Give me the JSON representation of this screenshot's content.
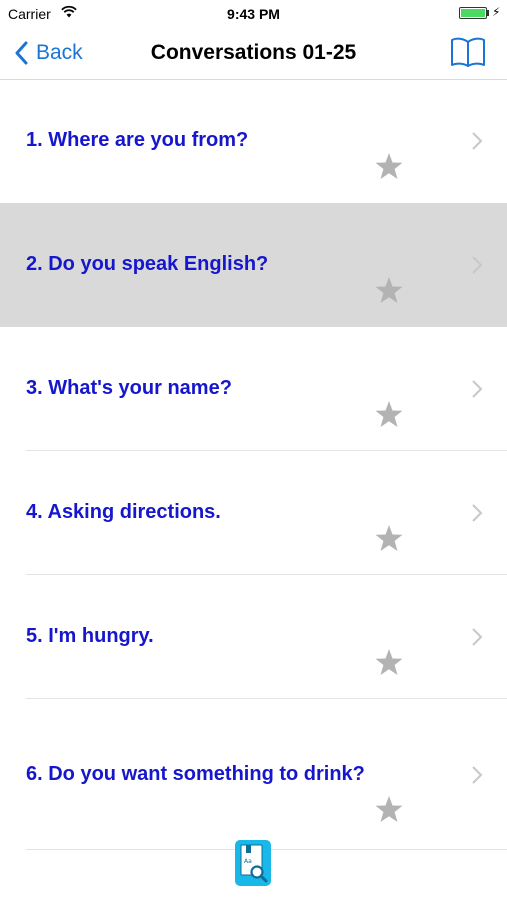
{
  "status": {
    "carrier": "Carrier",
    "time": "9:43 PM"
  },
  "nav": {
    "back_label": "Back",
    "title": "Conversations 01-25",
    "book_icon": "book-open-icon"
  },
  "conversations": [
    {
      "label": "1. Where are you from?",
      "selected": false,
      "favorite": false
    },
    {
      "label": "2. Do you speak English?",
      "selected": true,
      "favorite": false
    },
    {
      "label": "3. What's your name?",
      "selected": false,
      "favorite": false
    },
    {
      "label": "4. Asking directions.",
      "selected": false,
      "favorite": false
    },
    {
      "label": "5. I'm hungry.",
      "selected": false,
      "favorite": false
    },
    {
      "label": "6. Do you want something to drink?",
      "selected": false,
      "favorite": false
    }
  ],
  "colors": {
    "accent": "#1a75d6",
    "item_text": "#1616cc",
    "selected_row": "#d9d9d9",
    "star": "#b3b3b3"
  },
  "bottom": {
    "dictionary_icon": "dictionary-search-icon"
  }
}
